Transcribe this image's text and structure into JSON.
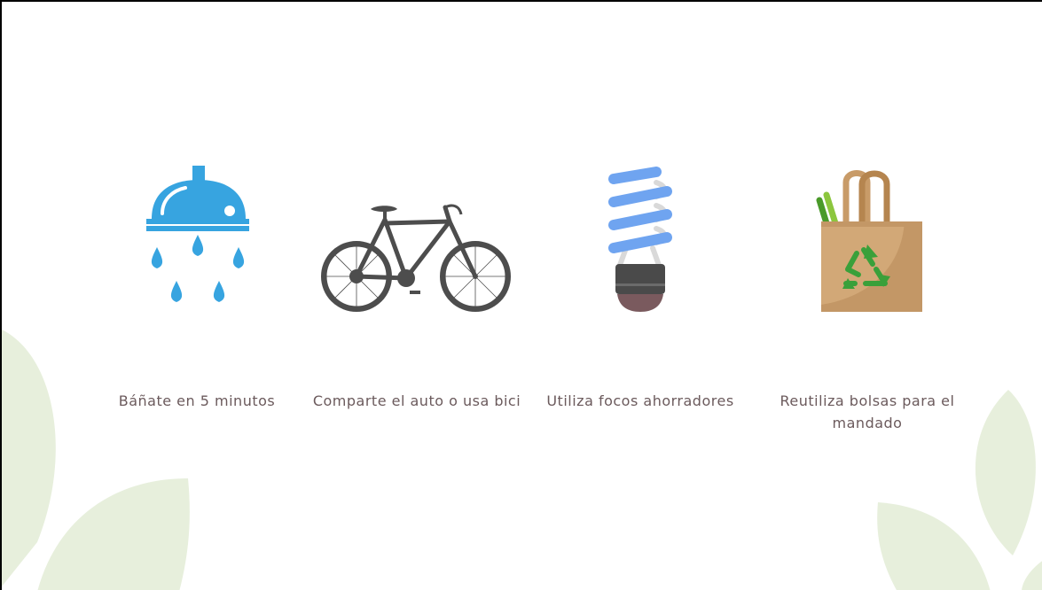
{
  "colors": {
    "background": "#ffffff",
    "leaf": "#e7efdc",
    "label_text": "#6b5a5c",
    "shower_blue": "#37a4e0",
    "bike_gray": "#4d4d4d",
    "bulb_blue": "#6fa4f0",
    "bulb_base": "#4a4a4a",
    "bulb_tip": "#7a5a5e",
    "bag_tan": "#d2a877",
    "recycle_green": "#3aa03a"
  },
  "tips": [
    {
      "icon": "shower-icon",
      "label": "Báñate en 5 minutos"
    },
    {
      "icon": "bicycle-icon",
      "label": "Comparte el auto o usa bici"
    },
    {
      "icon": "light-bulb-icon",
      "label": "Utiliza focos ahorradores"
    },
    {
      "icon": "recycle-bag-icon",
      "label": "Reutiliza bolsas para el mandado"
    }
  ]
}
